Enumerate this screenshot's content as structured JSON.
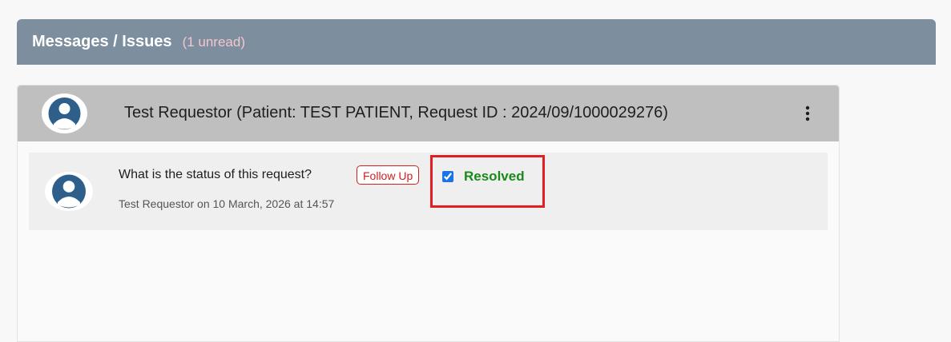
{
  "header": {
    "title": "Messages / Issues",
    "unread": "(1 unread)"
  },
  "thread": {
    "title": "Test Requestor (Patient: TEST PATIENT, Request ID : 2024/09/1000029276)",
    "avatar_icon": "user-avatar-icon",
    "menu_icon": "more-vertical-icon"
  },
  "message": {
    "text": "What is the status of this request?",
    "meta": "Test Requestor on 10 March, 2026 at 14:57",
    "followup_label": "Follow Up",
    "resolved_label": "Resolved",
    "resolved_checked": true
  },
  "colors": {
    "header_bg": "#7d8f9e",
    "unread": "#f4c6cf",
    "avatar": "#2d5f8a",
    "followup": "#d02020",
    "resolved": "#1a8a1a",
    "highlight": "#e02020"
  }
}
